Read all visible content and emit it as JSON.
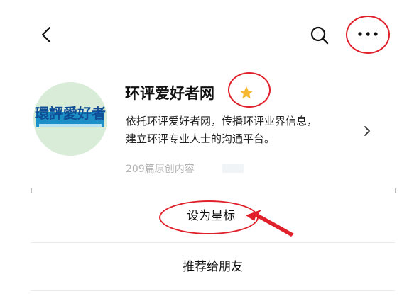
{
  "header": {
    "back_icon": "chevron-left-icon",
    "search_icon": "search-icon",
    "more_icon": "more-horizontal-icon"
  },
  "account": {
    "name": "环评爱好者网",
    "starred": true,
    "description_line1": "依托环评爱好者网，传播环评业界信息，",
    "description_line2": "建立环评专业人士的沟通平台。",
    "articles": "209篇原创内容",
    "logo_text": "環評愛好者"
  },
  "menu": {
    "set_star": "设为星标",
    "recommend": "推荐给朋友"
  },
  "colors": {
    "annotation_red": "#e0202a",
    "star_gold": "#f5b82e",
    "logo_blue": "#0f4e95",
    "muted_gray": "#b2b2b2"
  }
}
